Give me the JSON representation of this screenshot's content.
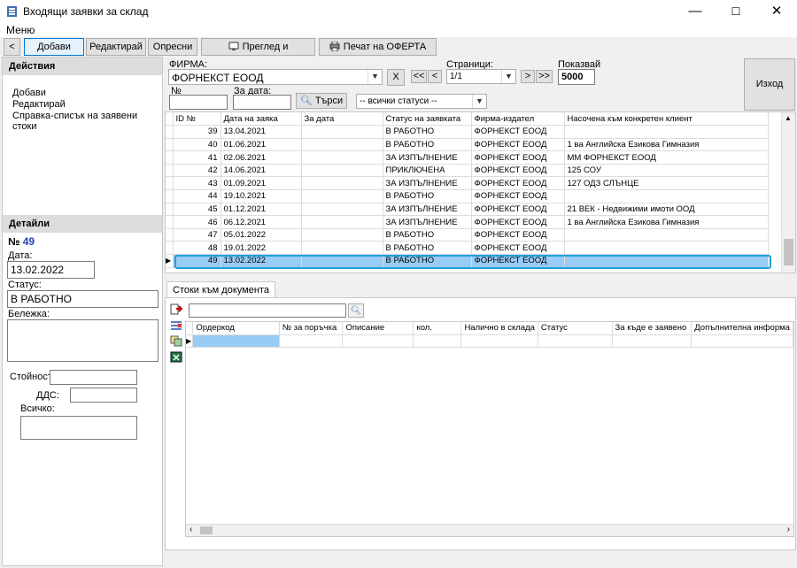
{
  "window": {
    "title": "Входящи заявки за склад"
  },
  "menu": {
    "items": [
      "Меню"
    ]
  },
  "toolbar": {
    "back_label": "<",
    "add_label": "Добави",
    "edit_label": "Редактирай",
    "refresh_label": "Опресни",
    "review_send_label": "Преглед и изпращане",
    "print_offer_label": "Печат на ОФЕРТА"
  },
  "actions": {
    "header": "Действия",
    "items": [
      "Добави",
      "Редактирай",
      "Справка-списък на заявени стоки"
    ]
  },
  "details": {
    "header": "Детайли",
    "number_prefix": "№",
    "number": "49",
    "date_label": "Дата:",
    "date_value": "13.02.2022",
    "status_label": "Статус:",
    "status_value": "В РАБОТНО",
    "note_label": "Бележка:",
    "value_label": "Стойност:",
    "vat_label": "ДДС:",
    "total_label": "Всичко:"
  },
  "filters": {
    "firm_label": "ФИРМА:",
    "firm_value": "ФОРНЕКСТ ЕООД",
    "clear_label": "X",
    "pages_label": "Страници:",
    "first_label": "<<",
    "prev_label": "<",
    "page_value": "1/1",
    "next_label": ">",
    "last_label": ">>",
    "show_label": "Показвай",
    "show_value": "5000",
    "exit_label": "Изход",
    "no_label": "№",
    "for_date_label": "За дата:",
    "search_label": "Търси",
    "status_value": "-- всички статуси --"
  },
  "grid": {
    "columns": [
      "ID №",
      "Дата на заяка",
      "За дата",
      "Статус на заявката",
      "Фирма-издател",
      "Насочена към конкретен клиент"
    ],
    "rows": [
      {
        "id": "39",
        "date": "13.04.2021",
        "for_date": "",
        "status": "В РАБОТНО",
        "firm": "ФОРНЕКСТ ЕООД",
        "client": ""
      },
      {
        "id": "40",
        "date": "01.06.2021",
        "for_date": "",
        "status": "В РАБОТНО",
        "firm": "ФОРНЕКСТ ЕООД",
        "client": "1 ва Английска Езикова Гимназия"
      },
      {
        "id": "41",
        "date": "02.06.2021",
        "for_date": "",
        "status": "ЗА ИЗПЪЛНЕНИЕ",
        "firm": "ФОРНЕКСТ ЕООД",
        "client": "ММ ФОРНЕКСТ ЕООД"
      },
      {
        "id": "42",
        "date": "14.06.2021",
        "for_date": "",
        "status": "ПРИКЛЮЧЕНА",
        "firm": "ФОРНЕКСТ ЕООД",
        "client": "125 СОУ"
      },
      {
        "id": "43",
        "date": "01.09.2021",
        "for_date": "",
        "status": "ЗА ИЗПЪЛНЕНИЕ",
        "firm": "ФОРНЕКСТ ЕООД",
        "client": "127 ОДЗ СЛЪНЦЕ"
      },
      {
        "id": "44",
        "date": "19.10.2021",
        "for_date": "",
        "status": "В РАБОТНО",
        "firm": "ФОРНЕКСТ ЕООД",
        "client": ""
      },
      {
        "id": "45",
        "date": "01.12.2021",
        "for_date": "",
        "status": "ЗА ИЗПЪЛНЕНИЕ",
        "firm": "ФОРНЕКСТ ЕООД",
        "client": "21 ВЕК - Недвижими имоти ООД"
      },
      {
        "id": "46",
        "date": "06.12.2021",
        "for_date": "",
        "status": "ЗА ИЗПЪЛНЕНИЕ",
        "firm": "ФОРНЕКСТ ЕООД",
        "client": "1 ва Английска Езикова Гимназия"
      },
      {
        "id": "47",
        "date": "05.01.2022",
        "for_date": "",
        "status": "В РАБОТНО",
        "firm": "ФОРНЕКСТ ЕООД",
        "client": ""
      },
      {
        "id": "48",
        "date": "19.01.2022",
        "for_date": "",
        "status": "В РАБОТНО",
        "firm": "ФОРНЕКСТ ЕООД",
        "client": ""
      },
      {
        "id": "49",
        "date": "13.02.2022",
        "for_date": "",
        "status": "В РАБОТНО",
        "firm": "ФОРНЕКСТ ЕООД",
        "client": ""
      }
    ],
    "selected_row": "49"
  },
  "docs": {
    "tab_label": "Стоки към документа",
    "columns": [
      "Ордеркод",
      "№ за поръчка",
      "Описание",
      "кол.",
      "Налично в склада",
      "Статус",
      "За къде е заявено",
      "Допълнителна информа"
    ]
  },
  "colors": {
    "selection": "#99ccf5",
    "accent": "#0078d7",
    "number_blue": "#1d3fb8"
  }
}
